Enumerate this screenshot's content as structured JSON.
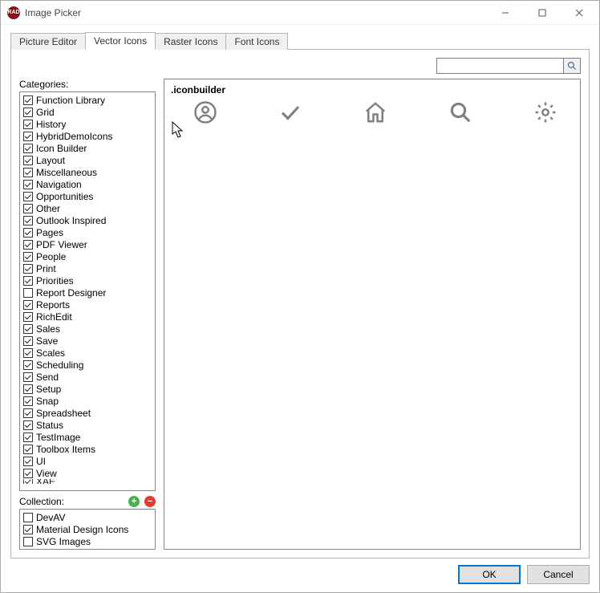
{
  "window": {
    "title": "Image Picker",
    "app_icon_text": "RAD"
  },
  "winbuttons": {
    "min": "minimize",
    "max": "maximize",
    "close": "close"
  },
  "tabs": {
    "t0": "Picture Editor",
    "t1": "Vector Icons",
    "t2": "Raster Icons",
    "t3": "Font Icons",
    "active_index": 1
  },
  "search": {
    "placeholder": ""
  },
  "labels": {
    "categories": "Categories:",
    "collection": "Collection:"
  },
  "categories": [
    {
      "label": "Function Library",
      "checked": true
    },
    {
      "label": "Grid",
      "checked": true
    },
    {
      "label": "History",
      "checked": true
    },
    {
      "label": "HybridDemoIcons",
      "checked": true
    },
    {
      "label": "Icon Builder",
      "checked": true
    },
    {
      "label": "Layout",
      "checked": true
    },
    {
      "label": "Miscellaneous",
      "checked": true
    },
    {
      "label": "Navigation",
      "checked": true
    },
    {
      "label": "Opportunities",
      "checked": true
    },
    {
      "label": "Other",
      "checked": true
    },
    {
      "label": "Outlook Inspired",
      "checked": true
    },
    {
      "label": "Pages",
      "checked": true
    },
    {
      "label": "PDF Viewer",
      "checked": true
    },
    {
      "label": "People",
      "checked": true
    },
    {
      "label": "Print",
      "checked": true
    },
    {
      "label": "Priorities",
      "checked": true
    },
    {
      "label": "Report Designer",
      "checked": false
    },
    {
      "label": "Reports",
      "checked": true
    },
    {
      "label": "RichEdit",
      "checked": true
    },
    {
      "label": "Sales",
      "checked": true
    },
    {
      "label": "Save",
      "checked": true
    },
    {
      "label": "Scales",
      "checked": true
    },
    {
      "label": "Scheduling",
      "checked": true
    },
    {
      "label": "Send",
      "checked": true
    },
    {
      "label": "Setup",
      "checked": true
    },
    {
      "label": "Snap",
      "checked": true
    },
    {
      "label": "Spreadsheet",
      "checked": true
    },
    {
      "label": "Status",
      "checked": true
    },
    {
      "label": "TestImage",
      "checked": true
    },
    {
      "label": "Toolbox Items",
      "checked": true
    },
    {
      "label": "UI",
      "checked": true
    },
    {
      "label": "View",
      "checked": true
    }
  ],
  "categories_cut": {
    "label": "XAF",
    "checked": true
  },
  "collection": [
    {
      "label": "DevAV",
      "checked": false
    },
    {
      "label": "Material Design Icons",
      "checked": true
    },
    {
      "label": "SVG Images",
      "checked": false
    }
  ],
  "results": {
    "group_header": ".iconbuilder",
    "icons": [
      "account-circle",
      "check",
      "home",
      "search",
      "settings-gear"
    ]
  },
  "buttons": {
    "ok": "OK",
    "cancel": "Cancel",
    "add": "+",
    "remove": "−"
  }
}
